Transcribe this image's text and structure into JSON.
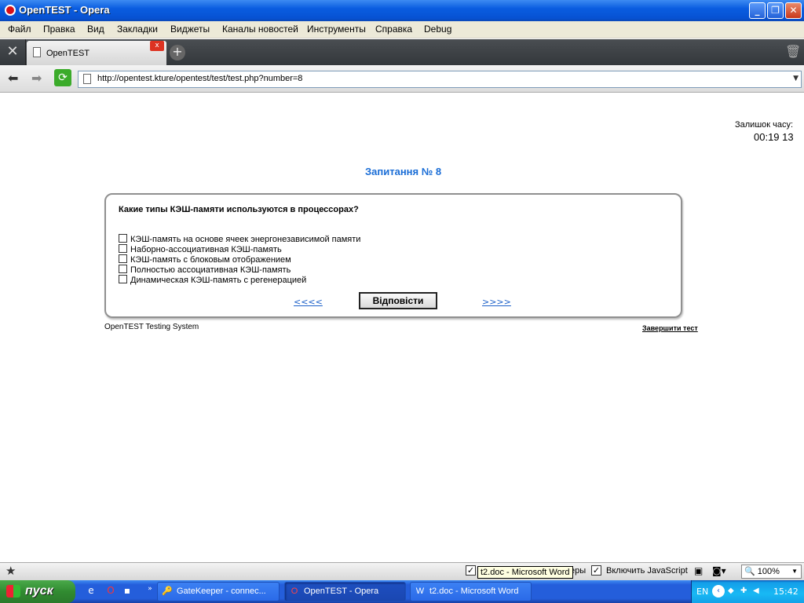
{
  "window": {
    "title": "OpenTEST - Opera"
  },
  "menu": [
    "Файл",
    "Правка",
    "Вид",
    "Закладки",
    "Виджеты",
    "Каналы новостей",
    "Инструменты",
    "Справка",
    "Debug"
  ],
  "tab": {
    "label": "OpenTEST"
  },
  "address": {
    "url": "http://opentest.kture/opentest/test/test.php?number=8"
  },
  "page": {
    "timer_label": "Залишок часу:",
    "timer_value": "00:19 13",
    "question_title": "Запитання № 8",
    "question_text": "Какие типы КЭШ-памяти используются в процессорах?",
    "options": [
      "КЭШ-память на основе ячеек энергонезависимой памяти",
      "Наборно-ассоциативная КЭШ-память",
      "КЭШ-память с блоковым отображением",
      "Полностью ассоциативная КЭШ-память",
      "Динамическая КЭШ-память с регенерацией"
    ],
    "prev_link": "<<<<",
    "answer_button": "Відповісти",
    "next_link": ">>>>",
    "footer_left": "OpenTEST Testing System",
    "footer_right": "Завершити тест"
  },
  "statusbar": {
    "tooltip": "t2.doc - Microsoft Word",
    "hidden_text_tail": "еры",
    "javascript_label": "Включить JavaScript",
    "zoom": "100%"
  },
  "taskbar": {
    "start_label": "пуск",
    "tasks": [
      "GateKeeper - connec...",
      "OpenTEST - Opera",
      "t2.doc - Microsoft Word"
    ],
    "lang": "EN",
    "clock": "15:42"
  }
}
